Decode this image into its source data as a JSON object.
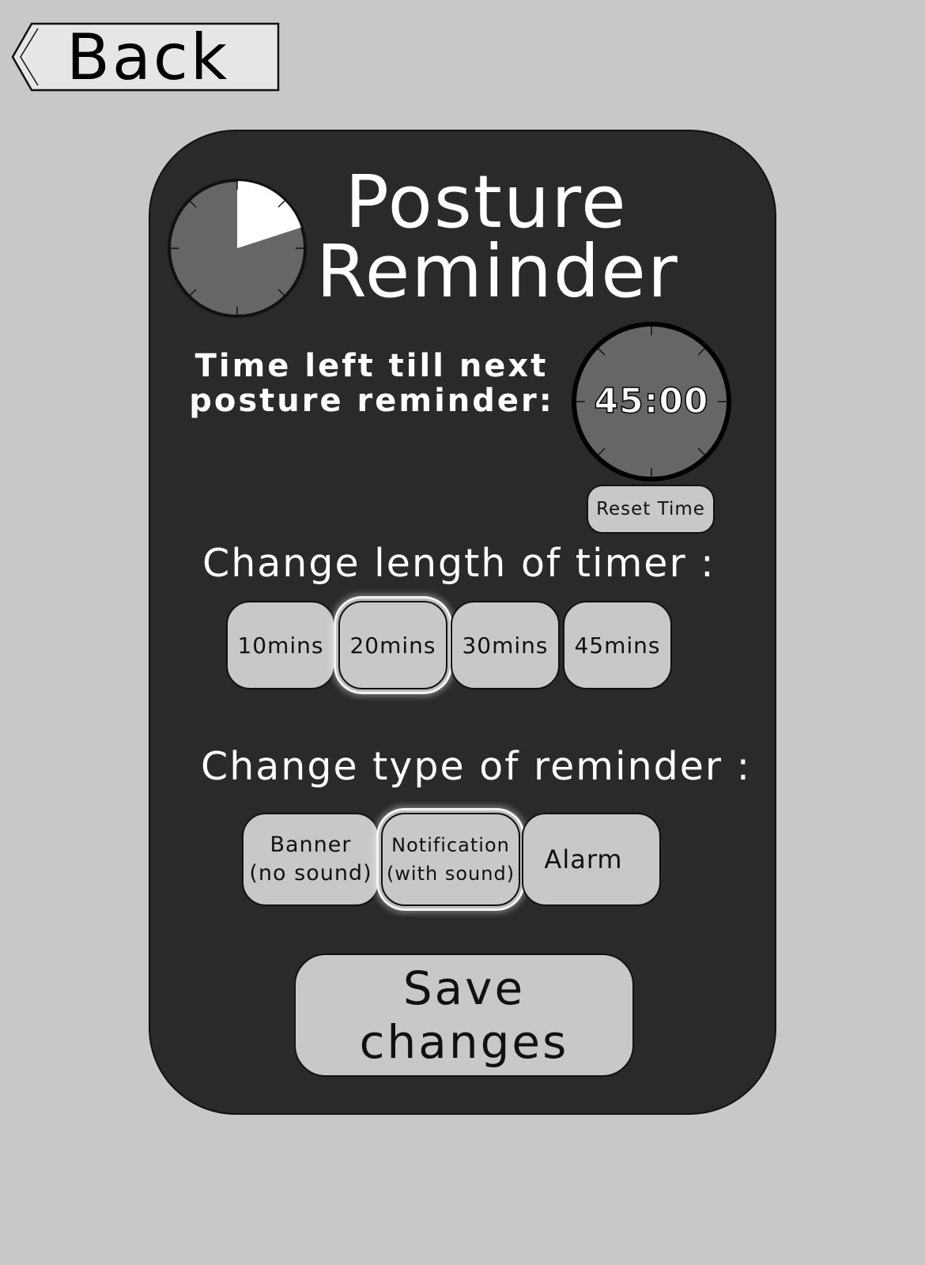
{
  "back": {
    "label": "Back"
  },
  "app": {
    "title_line1": "Posture",
    "title_line2": "Reminder"
  },
  "countdown": {
    "label_line1": "Time left till next",
    "label_line2": "posture reminder:",
    "value": "45:00",
    "elapsed_fraction": 0.2
  },
  "reset": {
    "label": "Reset Time"
  },
  "timer_length": {
    "label": "Change length of timer :",
    "options": [
      "10mins",
      "20mins",
      "30mins",
      "45mins"
    ],
    "selected": "20mins"
  },
  "reminder_type": {
    "label": "Change type of reminder :",
    "options": [
      {
        "line1": "Banner",
        "line2": "(no sound)"
      },
      {
        "line1": "Notification",
        "line2": "(with sound)"
      },
      {
        "line1": "Alarm",
        "line2": ""
      }
    ],
    "selected": "Notification"
  },
  "save": {
    "label": "Save changes"
  },
  "colors": {
    "background": "#c8c8c8",
    "panel": "#2a2a2a",
    "button": "#c8c8c8",
    "dial": "#666666",
    "text_light": "#ffffff"
  }
}
